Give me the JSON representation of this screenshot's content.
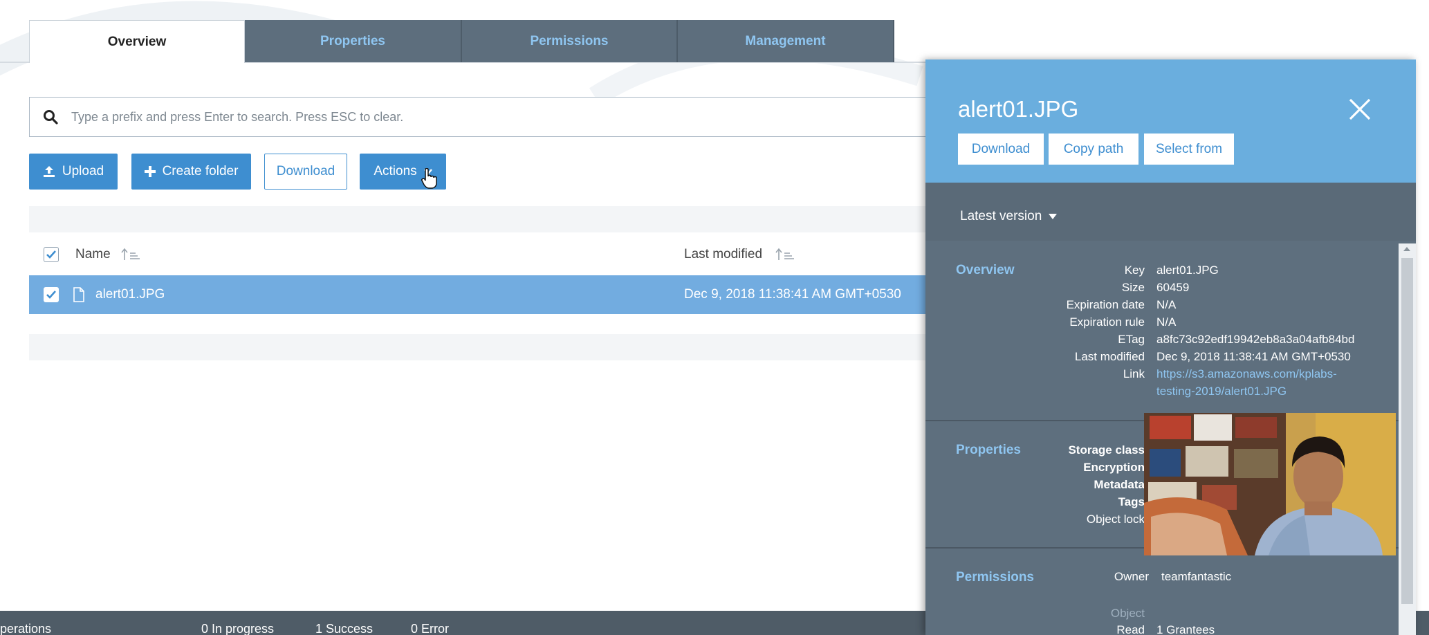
{
  "tabs": [
    {
      "label": "Overview",
      "active": true
    },
    {
      "label": "Properties",
      "active": false
    },
    {
      "label": "Permissions",
      "active": false
    },
    {
      "label": "Management",
      "active": false
    }
  ],
  "search": {
    "placeholder": "Type a prefix and press Enter to search. Press ESC to clear.",
    "icon": "search-icon"
  },
  "toolbar": {
    "upload_label": "Upload",
    "create_folder_label": "Create folder",
    "download_label": "Download",
    "actions_label": "Actions"
  },
  "table": {
    "columns": [
      {
        "label": "Name"
      },
      {
        "label": "Last modified"
      }
    ],
    "rows": [
      {
        "name": "alert01.JPG",
        "last_modified": "Dec 9, 2018 11:38:41 AM GMT+0530",
        "selected": true
      }
    ]
  },
  "status_bar": {
    "operations": "perations",
    "in_progress": "0 In progress",
    "success": "1 Success",
    "error": "0 Error"
  },
  "panel": {
    "title": "alert01.JPG",
    "buttons": {
      "download": "Download",
      "copy_path": "Copy path",
      "select_from": "Select from"
    },
    "version": "Latest version",
    "overview": {
      "title": "Overview",
      "fields": [
        {
          "key": "Key",
          "value": "alert01.JPG"
        },
        {
          "key": "Size",
          "value": "60459"
        },
        {
          "key": "Expiration date",
          "value": "N/A"
        },
        {
          "key": "Expiration rule",
          "value": "N/A"
        },
        {
          "key": "ETag",
          "value": "a8fc73c92edf19942eb8a3a04afb84bd"
        },
        {
          "key": "Last modified",
          "value": "Dec 9, 2018 11:38:41 AM GMT+0530"
        },
        {
          "key": "Link",
          "value": "https://s3.amazonaws.com/kplabs-testing-2019/alert01.JPG"
        }
      ]
    },
    "properties": {
      "title": "Properties",
      "fields": [
        {
          "key": "Storage class"
        },
        {
          "key": "Encryption"
        },
        {
          "key": "Metadata"
        },
        {
          "key": "Tags"
        },
        {
          "key": "Object lock"
        }
      ]
    },
    "permissions": {
      "title": "Permissions",
      "owner_key": "Owner",
      "owner_value": "teamfantastic",
      "object_label": "Object",
      "read_key": "Read",
      "read_value": "1 Grantees"
    }
  },
  "colors": {
    "accent": "#3e8ed0",
    "tab_inactive": "#5d6e7d",
    "selected_row": "#72ace0",
    "panel_header": "#6aaede",
    "panel_body": "#5e6f7e",
    "link": "#8fc6f1"
  }
}
